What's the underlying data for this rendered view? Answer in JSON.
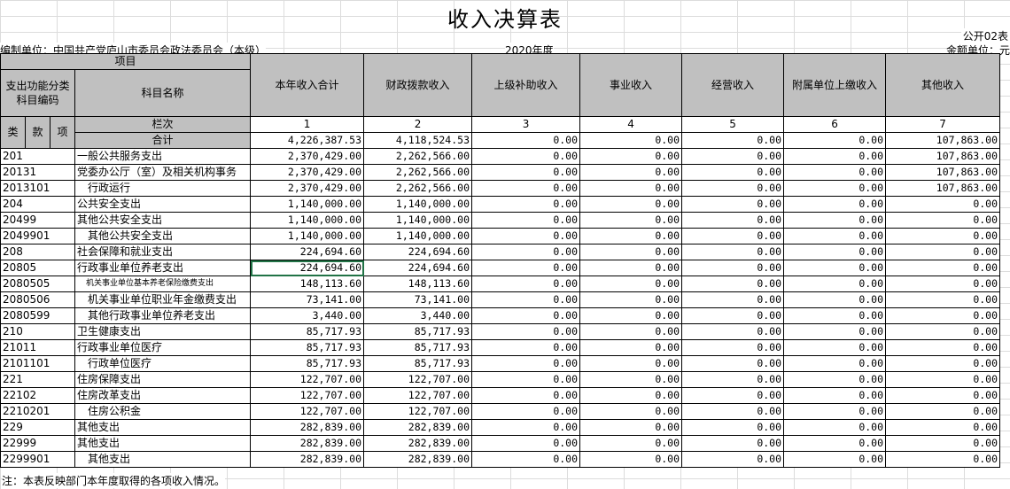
{
  "title": "收入决算表",
  "form_code": "公开02表",
  "org_label": "编制单位：中国共产党庐山市委员会政法委员会（本级）",
  "year": "2020年度",
  "unit_label": "金额单位：元",
  "header": {
    "item": "项目",
    "code_header": "支出功能分类科目编码",
    "name_header": "科目名称",
    "lan_ci": "栏次",
    "total_label": "合计",
    "lei": "类",
    "kuan": "款",
    "xiang": "项",
    "columns": [
      "本年收入合计",
      "财政拨款收入",
      "上级补助收入",
      "事业收入",
      "经营收入",
      "附属单位上缴收入",
      "其他收入"
    ],
    "col_numbers": [
      "1",
      "2",
      "3",
      "4",
      "5",
      "6",
      "7"
    ]
  },
  "total_row": [
    "4,226,387.53",
    "4,118,524.53",
    "0.00",
    "0.00",
    "0.00",
    "0.00",
    "107,863.00"
  ],
  "rows": [
    {
      "code": "201",
      "name": "一般公共服务支出",
      "values": [
        "2,370,429.00",
        "2,262,566.00",
        "0.00",
        "0.00",
        "0.00",
        "0.00",
        "107,863.00"
      ]
    },
    {
      "code": "20131",
      "name": "党委办公厅（室）及相关机构事务",
      "values": [
        "2,370,429.00",
        "2,262,566.00",
        "0.00",
        "0.00",
        "0.00",
        "0.00",
        "107,863.00"
      ]
    },
    {
      "code": "2013101",
      "name": "行政运行",
      "values": [
        "2,370,429.00",
        "2,262,566.00",
        "0.00",
        "0.00",
        "0.00",
        "0.00",
        "107,863.00"
      ]
    },
    {
      "code": "204",
      "name": "公共安全支出",
      "values": [
        "1,140,000.00",
        "1,140,000.00",
        "0.00",
        "0.00",
        "0.00",
        "0.00",
        "0.00"
      ]
    },
    {
      "code": "20499",
      "name": "其他公共安全支出",
      "values": [
        "1,140,000.00",
        "1,140,000.00",
        "0.00",
        "0.00",
        "0.00",
        "0.00",
        "0.00"
      ]
    },
    {
      "code": "2049901",
      "name": "其他公共安全支出",
      "values": [
        "1,140,000.00",
        "1,140,000.00",
        "0.00",
        "0.00",
        "0.00",
        "0.00",
        "0.00"
      ]
    },
    {
      "code": "208",
      "name": "社会保障和就业支出",
      "values": [
        "224,694.60",
        "224,694.60",
        "0.00",
        "0.00",
        "0.00",
        "0.00",
        "0.00"
      ]
    },
    {
      "code": "20805",
      "name": "行政事业单位养老支出",
      "values": [
        "224,694.60",
        "224,694.60",
        "0.00",
        "0.00",
        "0.00",
        "0.00",
        "0.00"
      ]
    },
    {
      "code": "2080505",
      "name": "机关事业单位基本养老保险缴费支出",
      "values": [
        "148,113.60",
        "148,113.60",
        "0.00",
        "0.00",
        "0.00",
        "0.00",
        "0.00"
      ]
    },
    {
      "code": "2080506",
      "name": "机关事业单位职业年金缴费支出",
      "values": [
        "73,141.00",
        "73,141.00",
        "0.00",
        "0.00",
        "0.00",
        "0.00",
        "0.00"
      ]
    },
    {
      "code": "2080599",
      "name": "其他行政事业单位养老支出",
      "values": [
        "3,440.00",
        "3,440.00",
        "0.00",
        "0.00",
        "0.00",
        "0.00",
        "0.00"
      ]
    },
    {
      "code": "210",
      "name": "卫生健康支出",
      "values": [
        "85,717.93",
        "85,717.93",
        "0.00",
        "0.00",
        "0.00",
        "0.00",
        "0.00"
      ]
    },
    {
      "code": "21011",
      "name": "行政事业单位医疗",
      "values": [
        "85,717.93",
        "85,717.93",
        "0.00",
        "0.00",
        "0.00",
        "0.00",
        "0.00"
      ]
    },
    {
      "code": "2101101",
      "name": "行政单位医疗",
      "values": [
        "85,717.93",
        "85,717.93",
        "0.00",
        "0.00",
        "0.00",
        "0.00",
        "0.00"
      ]
    },
    {
      "code": "221",
      "name": "住房保障支出",
      "values": [
        "122,707.00",
        "122,707.00",
        "0.00",
        "0.00",
        "0.00",
        "0.00",
        "0.00"
      ]
    },
    {
      "code": "22102",
      "name": "住房改革支出",
      "values": [
        "122,707.00",
        "122,707.00",
        "0.00",
        "0.00",
        "0.00",
        "0.00",
        "0.00"
      ]
    },
    {
      "code": "2210201",
      "name": "住房公积金",
      "values": [
        "122,707.00",
        "122,707.00",
        "0.00",
        "0.00",
        "0.00",
        "0.00",
        "0.00"
      ]
    },
    {
      "code": "229",
      "name": "其他支出",
      "values": [
        "282,839.00",
        "282,839.00",
        "0.00",
        "0.00",
        "0.00",
        "0.00",
        "0.00"
      ]
    },
    {
      "code": "22999",
      "name": "其他支出",
      "values": [
        "282,839.00",
        "282,839.00",
        "0.00",
        "0.00",
        "0.00",
        "0.00",
        "0.00"
      ]
    },
    {
      "code": "2299901",
      "name": "其他支出",
      "values": [
        "282,839.00",
        "282,839.00",
        "0.00",
        "0.00",
        "0.00",
        "0.00",
        "0.00"
      ]
    }
  ],
  "note": "注：本表反映部门本年度取得的各项收入情况。"
}
